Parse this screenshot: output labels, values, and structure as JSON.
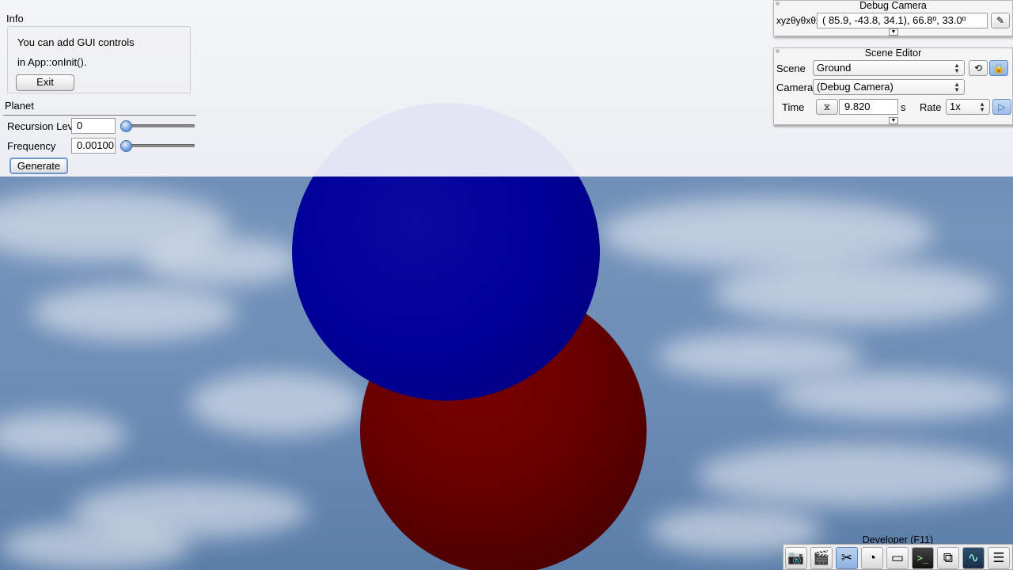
{
  "info": {
    "title": "Info",
    "line1": "You can add GUI controls",
    "line2": "in App::onInit().",
    "exit_label": "Exit"
  },
  "planet": {
    "title": "Planet",
    "recursion_label": "Recursion Level",
    "recursion_value": "0",
    "frequency_label": "Frequency",
    "frequency_value": "0.00100",
    "generate_label": "Generate"
  },
  "debug_camera": {
    "title": "Debug Camera",
    "coord_label": "xyzθyθxθz",
    "coord_value": "( 85.9, -43.8,  34.1),  66.8º,  33.0º"
  },
  "scene_editor": {
    "title": "Scene Editor",
    "scene_label": "Scene",
    "scene_value": "Ground",
    "camera_label": "Camera",
    "camera_value": "(Debug Camera)",
    "time_label": "Time",
    "time_value": "9.820",
    "time_unit": "s",
    "rate_label": "Rate",
    "rate_value": "1x"
  },
  "developer": {
    "title": "Developer (F11)",
    "tools": [
      "camera-icon",
      "film-clapper-icon",
      "tools-icon",
      "speedometer-icon",
      "notepad-icon",
      "terminal-icon",
      "scene-graph-icon",
      "profiler-icon",
      "document-icon"
    ]
  },
  "colors": {
    "sphere_blue": "#00009a",
    "sphere_red": "#6a0000",
    "sky": "#6f8db3",
    "accent_selected": "#8db1e0"
  }
}
